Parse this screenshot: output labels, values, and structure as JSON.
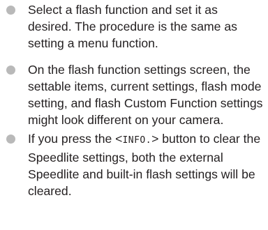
{
  "colors": {
    "text": "#231f20",
    "bullet": "#b9b9b9",
    "background": "#ffffff"
  },
  "bullets": [
    {
      "text": "Select a flash function and set it as desired. The procedure is the same as setting a menu function."
    },
    {
      "text": "On the flash function settings screen, the settable items, current settings, flash mode setting, and flash Custom Function settings might look different on your camera."
    },
    {
      "before": "If you press the <",
      "button_label": "INFO.",
      "after": "> button to clear the Speedlite settings, both the external Speedlite and built-in flash settings will be cleared."
    }
  ],
  "icons": {
    "bullet": "bullet-dot-icon"
  }
}
